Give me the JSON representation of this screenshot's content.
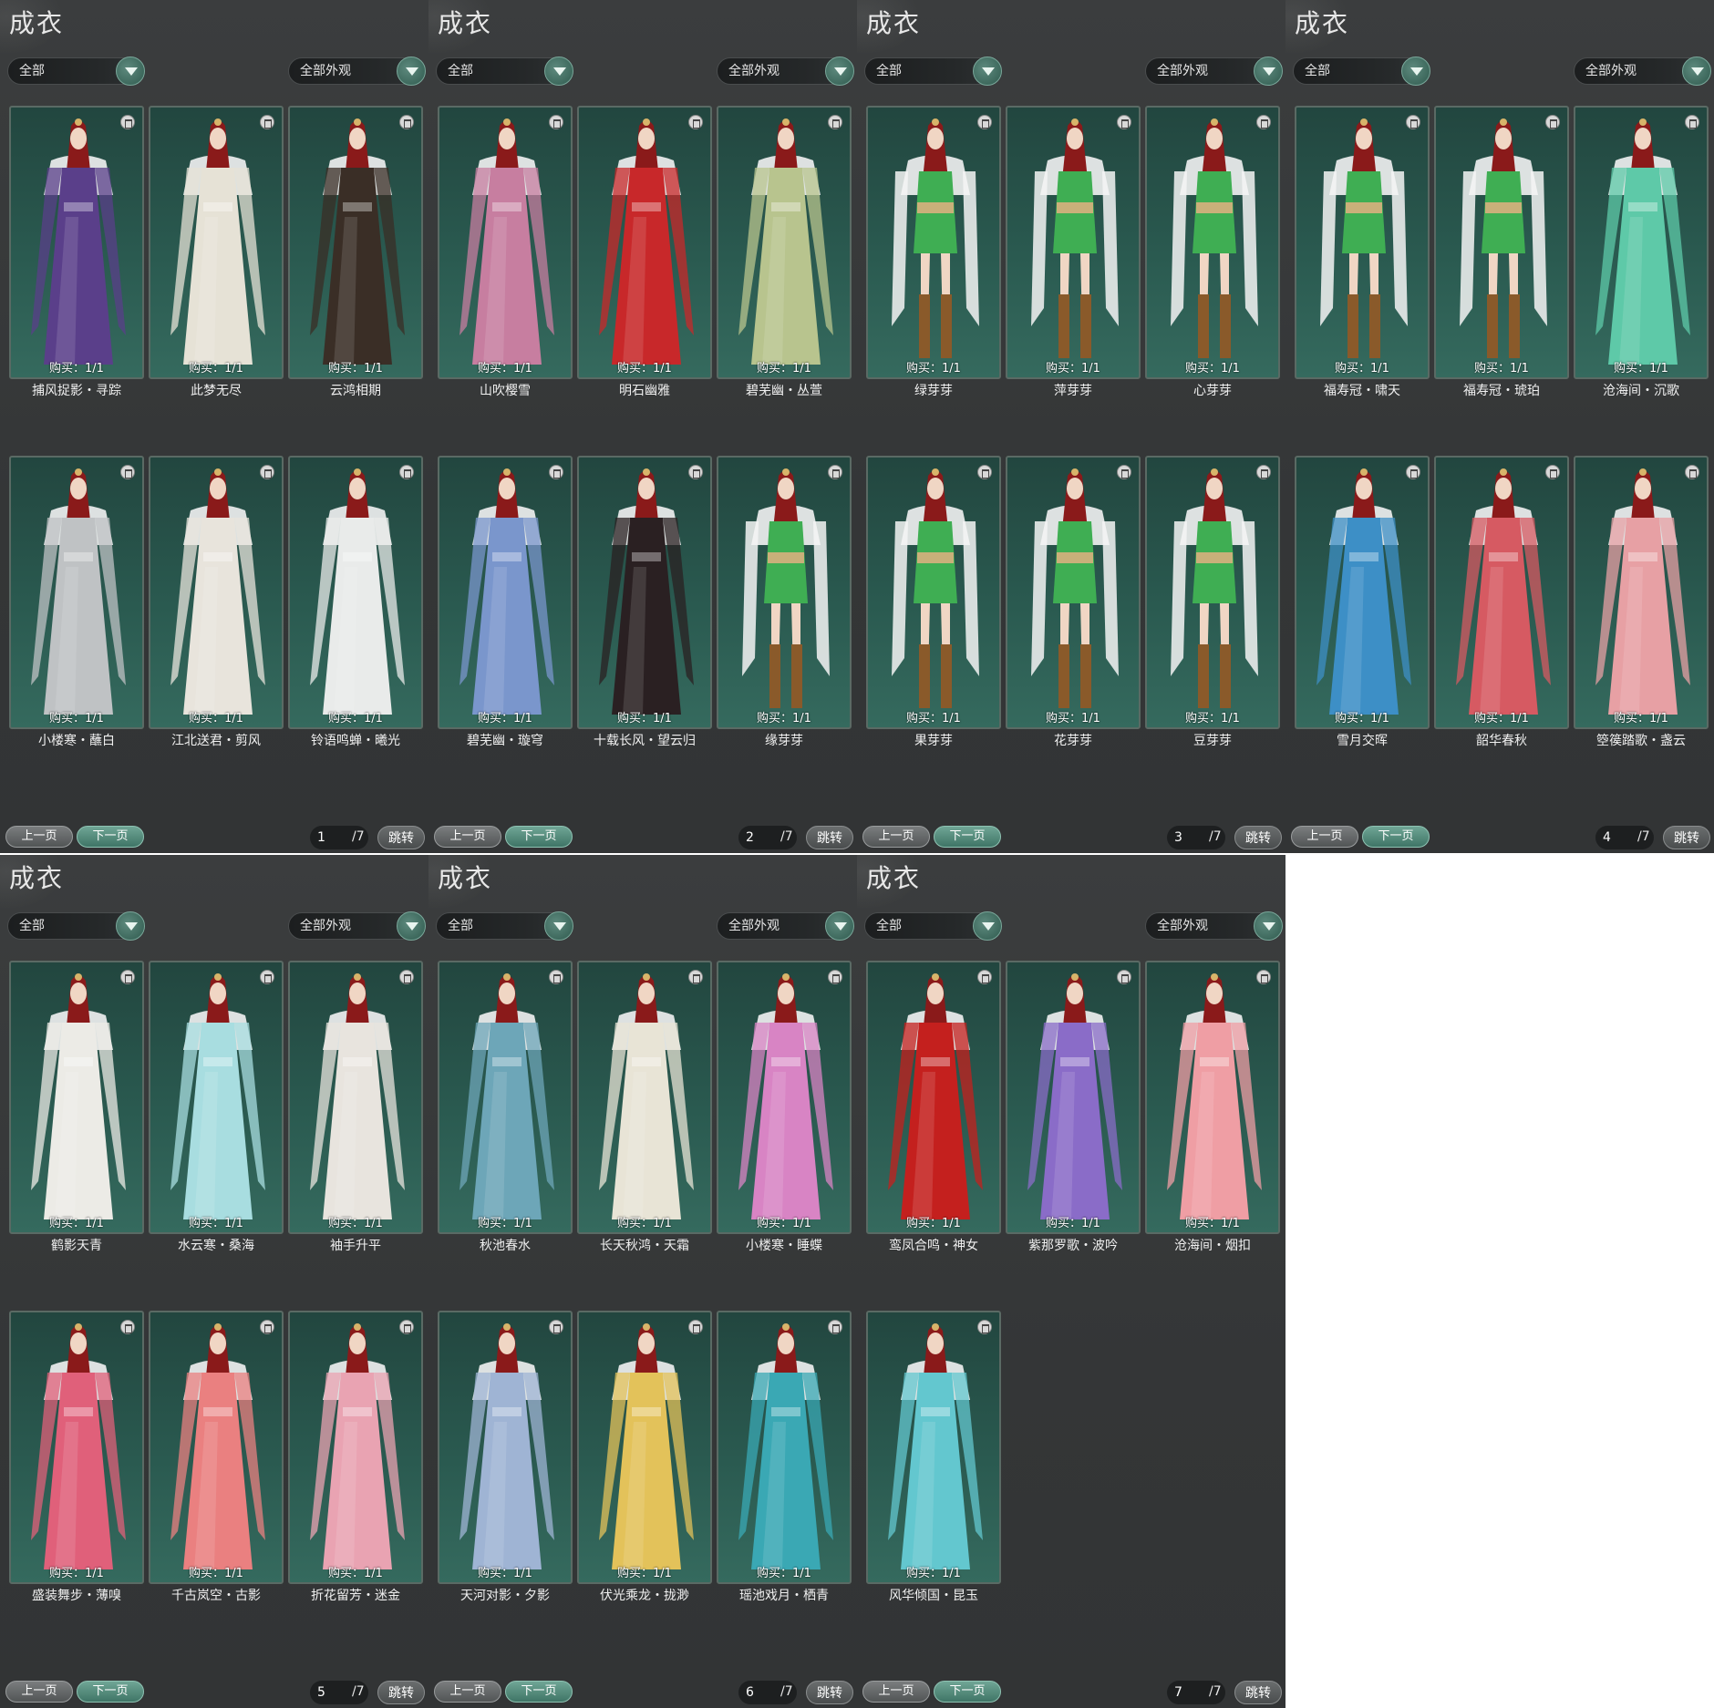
{
  "common": {
    "title": "成衣",
    "filter_left": "全部",
    "filter_right": "全部外观",
    "buy_label": "购买：1/1",
    "prev_label": "上一页",
    "next_label": "下一页",
    "jump_label": "跳转",
    "total_pages": "/7"
  },
  "panels": [
    {
      "page": "1",
      "items": [
        "捕风捉影・寻踪",
        "此梦无尽",
        "云鸿相期",
        "小楼寒・蘸白",
        "江北送君・剪风",
        "铃语鸣蝉・曦光"
      ],
      "colors": [
        "#5a3f8a",
        "#e6e2d6",
        "#3a2e26",
        "#bfc2c4",
        "#e8e4dc",
        "#e9ebea"
      ]
    },
    {
      "page": "2",
      "items": [
        "山吹樱雪",
        "明石幽雅",
        "碧芜幽・丛萱",
        "碧芜幽・璇穹",
        "十载长风・望云归",
        "缘芽芽"
      ],
      "colors": [
        "#c77ea0",
        "#c8282a",
        "#b8c48e",
        "#7a96cc",
        "#2a2022",
        "#3fae53"
      ]
    },
    {
      "page": "3",
      "items": [
        "绿芽芽",
        "萍芽芽",
        "心芽芽",
        "果芽芽",
        "花芽芽",
        "豆芽芽"
      ],
      "colors": [
        "#3fae53",
        "#3fae53",
        "#3fae53",
        "#3fae53",
        "#3fae53",
        "#3fae53"
      ]
    },
    {
      "page": "4",
      "items": [
        "福寿冠・啸天",
        "福寿冠・琥珀",
        "沧海间・沉歌",
        "雪月交晖",
        "韶华春秋",
        "箜篌踏歌・盏云"
      ],
      "colors": [
        "#3fae53",
        "#3fae53",
        "#5ec9a8",
        "#3d8fc6",
        "#d65a62",
        "#e7a0a4"
      ]
    },
    {
      "page": "5",
      "items": [
        "鹤影天青",
        "水云寒・桑海",
        "袖手升平",
        "盛装舞步・薄嗅",
        "千古岚空・古影",
        "折花留芳・迷金"
      ],
      "colors": [
        "#ecebe6",
        "#a8dde0",
        "#e8e4de",
        "#e0607a",
        "#ea8080",
        "#e9a3b2"
      ]
    },
    {
      "page": "6",
      "items": [
        "秋池春水",
        "长天秋鸿・天霜",
        "小楼寒・睡蝶",
        "天河对影・夕影",
        "伏光乘龙・拢渺",
        "瑶池戏月・栖青"
      ],
      "colors": [
        "#6da6b8",
        "#e8e4d6",
        "#d884c4",
        "#9fb4d4",
        "#e3c25a",
        "#3aa8b4"
      ]
    },
    {
      "page": "7",
      "items": [
        "鸾凤合鸣・神女",
        "紫那罗歌・波吟",
        "沧海间・烟扣",
        "风华倾国・昆玉"
      ],
      "colors": [
        "#c4201e",
        "#8a6cc8",
        "#ef9ea4",
        "#63c7cf"
      ]
    }
  ]
}
